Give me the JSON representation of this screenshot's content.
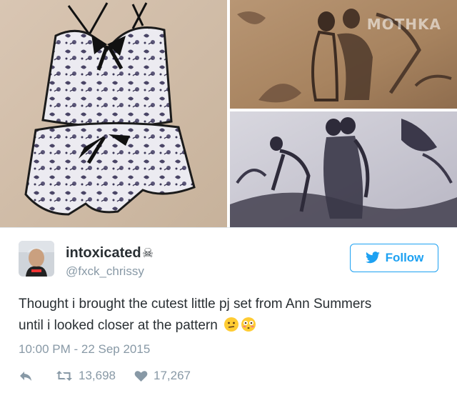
{
  "watermark": "MOTHKA",
  "tweet": {
    "display_name": "intoxicated",
    "name_badge_icon": "skull-crossbones-icon",
    "handle": "@fxck_chrissy",
    "follow_label": "Follow",
    "text_line1": "Thought i brought the cutest little pj set from Ann Summers",
    "text_line2": "until i looked closer at the pattern",
    "emojis": [
      "confused-face-emoji",
      "flushed-face-emoji"
    ],
    "timestamp": "10:00 PM - 22 Sep 2015",
    "retweets": "13,698",
    "likes": "17,267"
  },
  "colors": {
    "twitter_blue": "#1da1f2",
    "muted_text": "#8899a6",
    "main_text": "#292f33"
  }
}
